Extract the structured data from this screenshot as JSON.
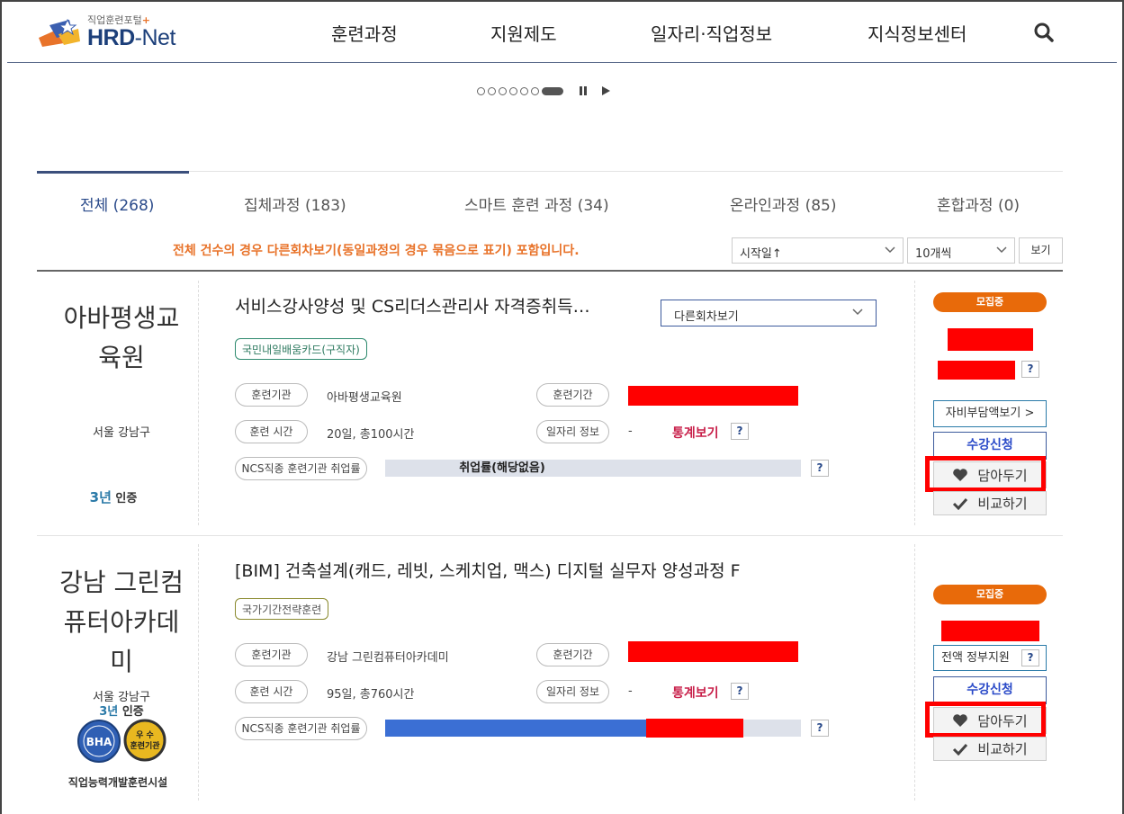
{
  "header": {
    "logo_sub": "직업훈련포털",
    "logo_main": "HRD",
    "logo_net": "-Net",
    "nav": [
      "훈련과정",
      "지원제도",
      "일자리·직업정보",
      "지식정보센터"
    ]
  },
  "tabs": [
    {
      "label": "전체 (268)",
      "active": true
    },
    {
      "label": "집체과정 (183)"
    },
    {
      "label": "스마트 훈련 과정 (34)"
    },
    {
      "label": "온라인과정 (85)"
    },
    {
      "label": "혼합과정 (0)"
    }
  ],
  "notice": "전체 건수의 경우 다른회차보기(동일과정의 경우 묶음으로 표기) 포함입니다.",
  "sort": {
    "selected": "시작일↑"
  },
  "per_page": {
    "selected": "10개씩"
  },
  "view_button": "보기",
  "common": {
    "label_institution": "훈련기관",
    "label_period": "훈련기간",
    "label_hours": "훈련 시간",
    "label_jobinfo": "일자리 정보",
    "label_ncs": "NCS직종 훈련기관 취업률",
    "stat_link": "통계보기",
    "q": "?",
    "badge": "모집중",
    "apply": "수강신청",
    "save": "담아두기",
    "compare": "비교하기",
    "dash": "-",
    "accent": "#e86a0a"
  },
  "courses": [
    {
      "institution": "아바평생교육원",
      "inst_line1": "아바평생교",
      "inst_line2": "육원",
      "region": "서울 강남구",
      "cert_years": "3년",
      "cert_label": "인증",
      "title": "서비스강사양성 및 CS리더스관리사 자격증취득…",
      "tag": "국민내일배움카드(구직자)",
      "institution_value": "아바평생교육원",
      "hours": "20일, 총100시간",
      "employment_text": "취업률(해당없음)",
      "other_rounds": "다른회차보기",
      "cost_button": "자비부담액보기 >"
    },
    {
      "institution": "강남 그린컴퓨터아카데미",
      "inst_line1": "강남 그린컴",
      "inst_line2": "퓨터아카데",
      "inst_line3": "미",
      "region": "서울 강남구",
      "cert_years": "3년",
      "cert_label": "인증",
      "seal_bha": "BHA",
      "seal_excellent_1": "우 수",
      "seal_excellent_2": "훈련기관",
      "facility": "직업능력개발훈련시설",
      "title": "[BIM] 건축설계(캐드, 레빗, 스케치업, 맥스) 디지털 실무자 양성과정 F",
      "tag": "국가기간전략훈련",
      "institution_value": "강남 그린컴퓨터아카데미",
      "hours": "95일, 총760시간",
      "employment_fraction": 0.63,
      "gov_support": "전액 정부지원"
    }
  ]
}
